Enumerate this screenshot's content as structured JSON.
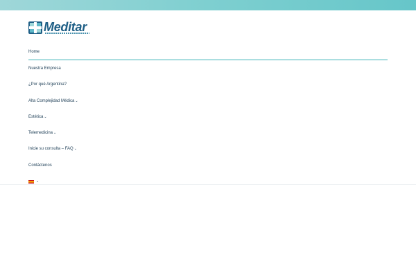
{
  "header": {
    "logo_text": "Meditar",
    "logo_icon": "medical-cross-icon",
    "colors": {
      "top_bar": "#7ecfd0",
      "accent": "#38b0b6",
      "brand": "#1f5f86"
    }
  },
  "nav": {
    "items": [
      {
        "label": "Home",
        "active": true,
        "has_dropdown": false
      },
      {
        "label": "Nuestra Empresa",
        "active": false,
        "has_dropdown": false
      },
      {
        "label": "¿Por qué Argentina?",
        "active": false,
        "has_dropdown": false
      },
      {
        "label": "Alta Complejidad Médica",
        "active": false,
        "has_dropdown": true
      },
      {
        "label": "Estética",
        "active": false,
        "has_dropdown": true
      },
      {
        "label": "Telemedicina",
        "active": false,
        "has_dropdown": true
      },
      {
        "label": "Inicie su consulta – FAQ",
        "active": false,
        "has_dropdown": true
      },
      {
        "label": "Contáctenos",
        "active": false,
        "has_dropdown": false
      }
    ],
    "language": {
      "icon": "spain-flag-icon",
      "has_dropdown": true
    }
  },
  "icons": {
    "dropdown": "chevron-down-icon",
    "dropdown_glyph": "⌄"
  }
}
